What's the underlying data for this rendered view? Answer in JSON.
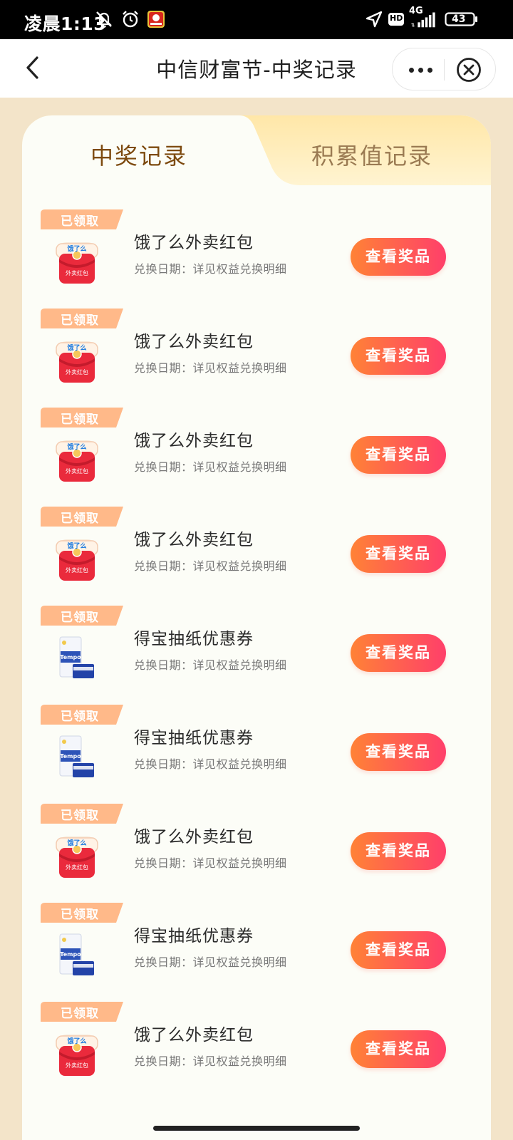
{
  "status_bar": {
    "time": "凌晨1:13",
    "network": "4G",
    "hd": "HD",
    "battery": "43"
  },
  "nav": {
    "title": "中信财富节-中奖记录"
  },
  "tabs": [
    {
      "label": "中奖记录",
      "active": true
    },
    {
      "label": "积累值记录",
      "active": false
    }
  ],
  "records": [
    {
      "badge": "已领取",
      "name": "饿了么外卖红包",
      "date": "兑换日期：详见权益兑换明细",
      "button": "查看奖品",
      "icon": "red-envelope-icon"
    },
    {
      "badge": "已领取",
      "name": "饿了么外卖红包",
      "date": "兑换日期：详见权益兑换明细",
      "button": "查看奖品",
      "icon": "red-envelope-icon"
    },
    {
      "badge": "已领取",
      "name": "饿了么外卖红包",
      "date": "兑换日期：详见权益兑换明细",
      "button": "查看奖品",
      "icon": "red-envelope-icon"
    },
    {
      "badge": "已领取",
      "name": "饿了么外卖红包",
      "date": "兑换日期：详见权益兑换明细",
      "button": "查看奖品",
      "icon": "red-envelope-icon"
    },
    {
      "badge": "已领取",
      "name": "得宝抽纸优惠券",
      "date": "兑换日期：详见权益兑换明细",
      "button": "查看奖品",
      "icon": "tissue-pack-icon"
    },
    {
      "badge": "已领取",
      "name": "得宝抽纸优惠券",
      "date": "兑换日期：详见权益兑换明细",
      "button": "查看奖品",
      "icon": "tissue-pack-icon"
    },
    {
      "badge": "已领取",
      "name": "饿了么外卖红包",
      "date": "兑换日期：详见权益兑换明细",
      "button": "查看奖品",
      "icon": "red-envelope-icon"
    },
    {
      "badge": "已领取",
      "name": "得宝抽纸优惠券",
      "date": "兑换日期：详见权益兑换明细",
      "button": "查看奖品",
      "icon": "tissue-pack-icon"
    },
    {
      "badge": "已领取",
      "name": "饿了么外卖红包",
      "date": "兑换日期：详见权益兑换明细",
      "button": "查看奖品",
      "icon": "red-envelope-icon"
    }
  ],
  "envelope_logo_text": "饿了么",
  "envelope_text": "外卖红包",
  "tissue_logo_text": "Tempo",
  "colors": {
    "page_bg": "#f3e4c9",
    "card_bg": "#fcfdf7",
    "active_tab_text": "#7d4a0f",
    "inactive_tab_text": "#9a7a52",
    "button_gradient_start": "#ff8236",
    "button_gradient_end": "#ff3f6a",
    "badge_color": "#ffb07a"
  }
}
